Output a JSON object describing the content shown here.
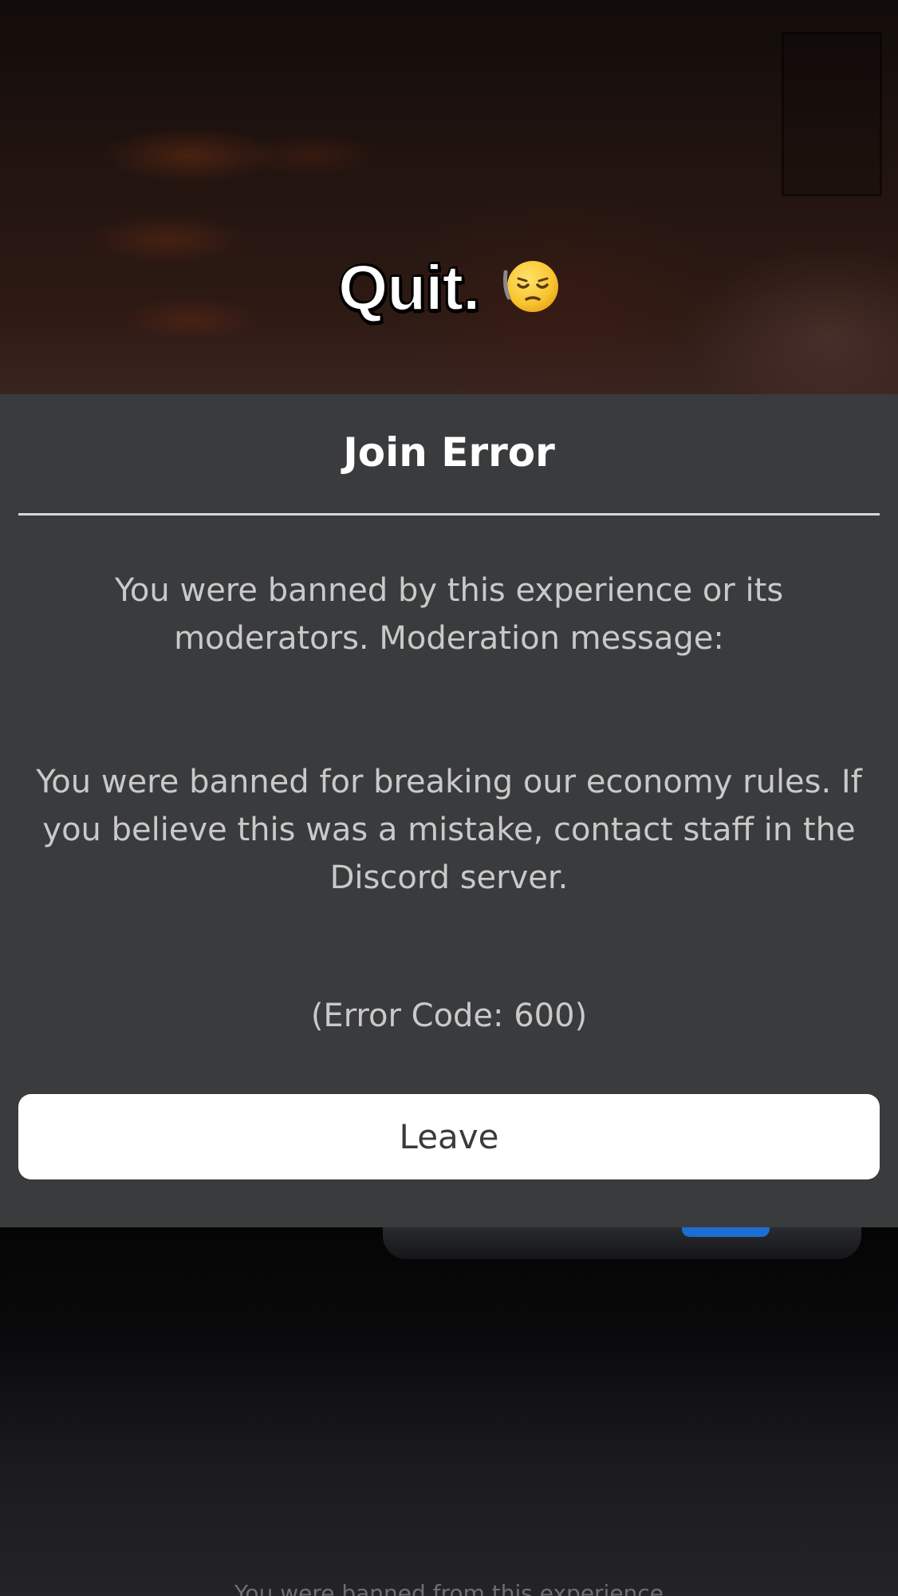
{
  "caption": {
    "text": "Quit.",
    "emoji": "pensive-face-with-hand-emoji"
  },
  "dialog": {
    "title": "Join Error",
    "message": "You were banned by this experience or its moderators. Moderation message:",
    "moderation_message": "You were banned for breaking our economy rules. If you believe this was a mistake, contact staff in the Discord server.",
    "error_code": "(Error Code: 600)",
    "leave_label": "Leave"
  },
  "background_text": "You were banned from this experience",
  "colors": {
    "panel": "#393b3d",
    "button": "#ffffff",
    "title": "#ffffff",
    "body_text": "#c9c9c9"
  }
}
